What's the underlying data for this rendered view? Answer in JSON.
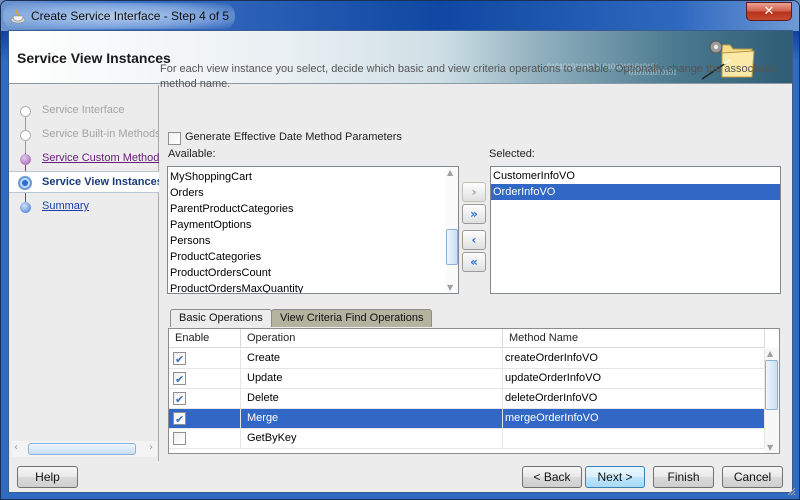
{
  "window": {
    "title": "Create Service Interface - Step 4 of 5",
    "close_label": "✕"
  },
  "header": {
    "title": "Service View Instances",
    "binary_text_1": "0101010101010101010101010101",
    "binary_text_2": "010101010101"
  },
  "nav": {
    "items": [
      {
        "label": "Service Interface",
        "state": "disabled"
      },
      {
        "label": "Service Built-in Methods",
        "state": "disabled"
      },
      {
        "label": "Service Custom Methods",
        "state": "visited"
      },
      {
        "label": "Service View Instances",
        "state": "current"
      },
      {
        "label": "Summary",
        "state": "link"
      }
    ]
  },
  "main": {
    "description": "For each view instance you select, decide which basic and view criteria operations to enable. Optionally change the associated method name.",
    "effective_date_checkbox": {
      "label": "Generate Effective Date Method Parameters",
      "checked": false
    },
    "available_label": "Available:",
    "selected_label": "Selected:",
    "available_items": [
      "MyShoppingCart",
      "Orders",
      "ParentProductCategories",
      "PaymentOptions",
      "Persons",
      "ProductCategories",
      "ProductOrdersCount",
      "ProductOrdersMaxQuantity"
    ],
    "selected_items": [
      "CustomerInfoVO",
      "OrderInfoVO"
    ],
    "selected_index": 1,
    "shuttle": {
      "move": "›",
      "move_all": "»",
      "remove": "‹",
      "remove_all": "«"
    },
    "tabs": [
      "Basic Operations",
      "View Criteria Find Operations"
    ],
    "active_tab": 0,
    "table": {
      "columns": [
        "Enable",
        "Operation",
        "Method Name"
      ],
      "rows": [
        {
          "enabled": true,
          "operation": "Create",
          "method": "createOrderInfoVO"
        },
        {
          "enabled": true,
          "operation": "Update",
          "method": "updateOrderInfoVO"
        },
        {
          "enabled": true,
          "operation": "Delete",
          "method": "deleteOrderInfoVO"
        },
        {
          "enabled": true,
          "operation": "Merge",
          "method": "mergeOrderInfoVO"
        },
        {
          "enabled": false,
          "operation": "GetByKey",
          "method": ""
        }
      ],
      "selected_row": 3
    }
  },
  "footer": {
    "help": "Help",
    "back": "< Back",
    "next": "Next >",
    "finish": "Finish",
    "cancel": "Cancel"
  }
}
